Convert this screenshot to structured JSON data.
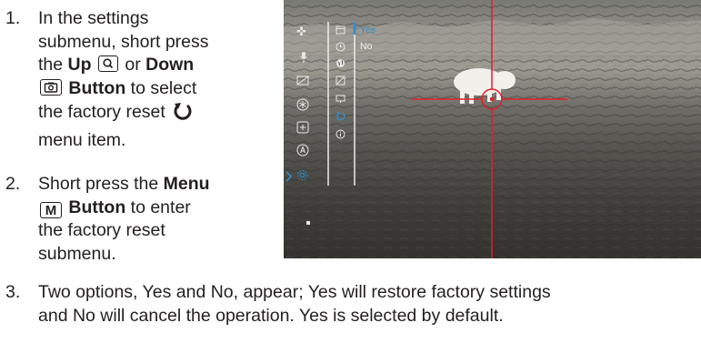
{
  "step1": {
    "number": "1.",
    "line1": "In the settings",
    "line2": "submenu, short press",
    "line3_pre": "the",
    "up_label": "Up",
    "line3_mid": "or",
    "down_label": "Down",
    "button_label": "Button",
    "line4_post": "to select",
    "line5": "the factory reset",
    "line6": "menu item.",
    "up_key_icon": "zoom-icon",
    "down_key_icon": "camera-icon",
    "reset_icon": "factory-reset-icon"
  },
  "step2": {
    "number": "2.",
    "line1_pre": "Short press the",
    "menu_label": "Menu",
    "menu_key": "M",
    "button_label": "Button",
    "line2_post": "to enter",
    "line3": "the factory reset",
    "line4": "submenu."
  },
  "step3": {
    "number": "3.",
    "line1": "Two options, Yes and No, appear; Yes will restore factory settings",
    "line2": "and No will cancel the operation. Yes is selected by default."
  },
  "screen": {
    "option_yes": "Yes",
    "option_no": "No",
    "selected_option": "Yes",
    "selection_color": "#2f8fd0",
    "reticle_color": "#e0202a",
    "left_menu_icons": [
      "crosshair-icon",
      "microphone-icon",
      "display-off-icon",
      "snowflake-icon",
      "plus-box-icon",
      "auto-icon",
      "settings-icon"
    ],
    "sub_menu_icons": [
      "calendar-icon",
      "clock-icon",
      "globe-icon",
      "calibration-icon",
      "screen-icon",
      "factory-reset-icon",
      "info-icon"
    ]
  }
}
